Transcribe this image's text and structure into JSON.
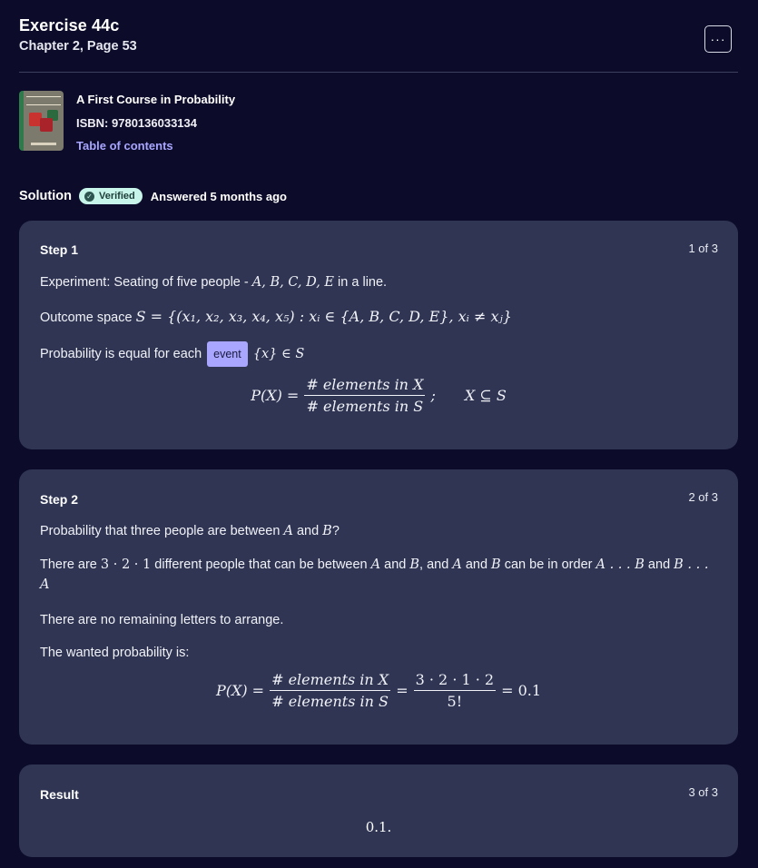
{
  "header": {
    "title": "Exercise 44c",
    "subtitle": "Chapter 2, Page 53",
    "more_label": "···"
  },
  "book": {
    "title": "A First Course in Probability",
    "isbn": "ISBN: 9780136033134",
    "toc_label": "Table of contents"
  },
  "solution": {
    "label": "Solution",
    "verified_label": "Verified",
    "answered": "Answered 5 months ago"
  },
  "steps": [
    {
      "title": "Step 1",
      "count": "1 of 3",
      "line1_pre": "Experiment: Seating of five people - ",
      "line1_math": "A, B, C, D, E",
      "line1_post": " in a line.",
      "line2_pre": "Outcome space ",
      "line2_math": "S = {(x₁, x₂, x₃, x₄, x₅) : xᵢ ∈ {A, B, C, D, E}, xᵢ ≠ xⱼ}",
      "line3_pre": "Probability is equal for each ",
      "line3_chip": "event",
      "line3_math": "{x} ∈ S",
      "formula_lhs": "P(X) =",
      "formula_num": "# elements in X",
      "formula_den": "# elements in S",
      "formula_rhs": ";  X ⊆ S"
    },
    {
      "title": "Step 2",
      "count": "2 of 3",
      "line1_pre": "Probability that three people are between ",
      "line1_a": "A",
      "line1_mid": " and ",
      "line1_b": "B",
      "line1_post": "?",
      "line2_pre": "There are ",
      "line2_math1": "3 · 2 · 1",
      "line2_mid1": " different people that can be between ",
      "line2_a": "A",
      "line2_and1": " and ",
      "line2_b": "B",
      "line2_mid2": ", and ",
      "line2_a2": "A",
      "line2_and2": " and ",
      "line2_b2": "B",
      "line2_mid3": " can be in order ",
      "line2_order1": "A . . . B",
      "line2_and3": " and ",
      "line2_order2": "B . . . A",
      "line3": "There are no remaining letters to arrange.",
      "line4": "The wanted probability is:",
      "formula_lhs": "P(X) =",
      "formula_num": "# elements in X",
      "formula_den": "# elements in S",
      "formula_eq": "=",
      "formula_num2": "3 · 2 · 1 · 2",
      "formula_den2": "5!",
      "formula_rhs": "= 0.1"
    },
    {
      "title": "Result",
      "count": "3 of 3",
      "value": "0.1."
    }
  ]
}
